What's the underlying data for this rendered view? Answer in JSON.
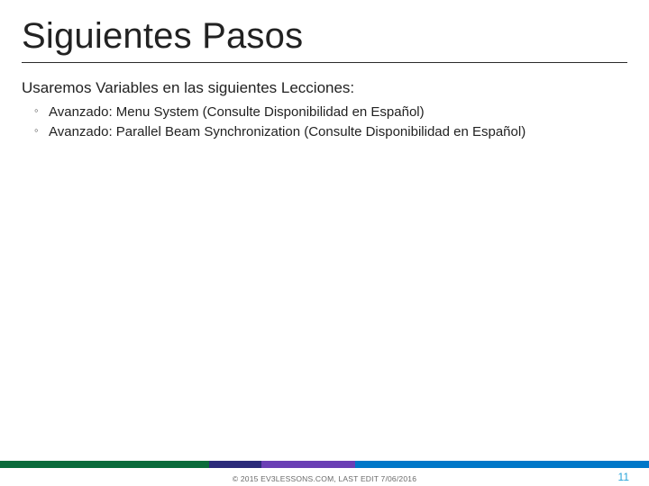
{
  "title": "Siguientes Pasos",
  "subhead": "Usaremos Variables en las siguientes Lecciones:",
  "bullets": [
    "Avanzado: Menu System (Consulte Disponibilidad en Español)",
    "Avanzado: Parallel Beam Synchronization (Consulte Disponibilidad en Español)"
  ],
  "copyright": "© 2015 EV3LESSONS.COM, LAST EDIT 7/06/2016",
  "page_number": "11",
  "stripe_colors": {
    "a": "#0a6b3b",
    "b": "#2b2b7a",
    "c": "#6a3fb5",
    "d": "#0077c8"
  }
}
